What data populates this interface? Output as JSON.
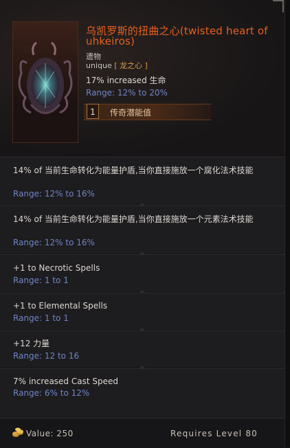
{
  "item": {
    "title": "乌凯罗斯的扭曲之心(twisted heart of uhkeiros)",
    "subtype": "遗物",
    "rarity_prefix": "unique",
    "rarity_class": "[ 龙之心 ]",
    "implicit": "17% increased 生命",
    "implicit_range": "Range: 12% to 20%",
    "legendary_potential": {
      "value": "1",
      "label": "传奇潜能值"
    }
  },
  "affixes": [
    {
      "text": "14% of 当前生命转化为能量护盾,当你直接施放一个腐化法术技能",
      "range": "Range: 12% to 16%"
    },
    {
      "text": "14% of 当前生命转化为能量护盾,当你直接施放一个元素法术技能",
      "range": "Range: 12% to 16%"
    },
    {
      "text": "+1 to Necrotic Spells",
      "range": "Range: 1 to 1"
    },
    {
      "text": "+1 to Elemental Spells",
      "range": "Range: 1 to 1"
    },
    {
      "text": "+12 力量",
      "range": "Range: 12 to 16"
    },
    {
      "text": "7% increased Cast Speed",
      "range": "Range: 6% to 12%"
    }
  ],
  "footer": {
    "value_label": "Value: 250",
    "requirement": "Requires Level 80"
  },
  "icons": {
    "item_art": "heart-relic-icon",
    "value": "gold-coins-icon"
  },
  "colors": {
    "unique_title": "#e6611f",
    "range": "#6f86c6",
    "text": "#ddd9d2"
  }
}
